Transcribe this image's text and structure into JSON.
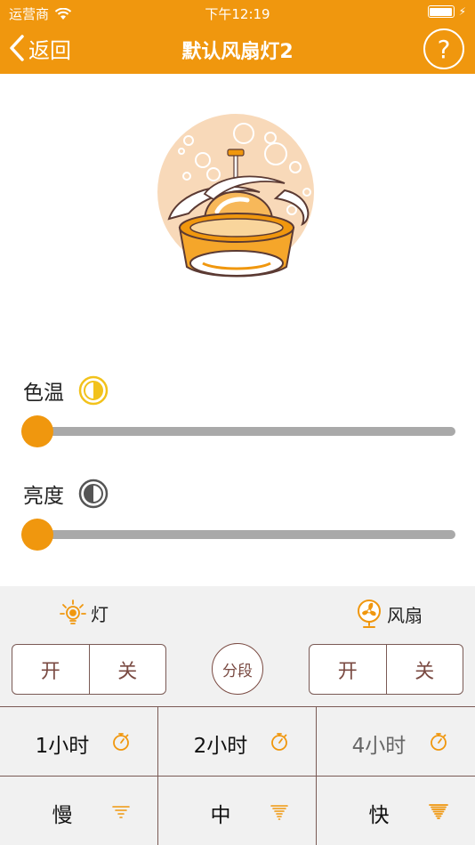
{
  "status_bar": {
    "carrier": "运营商",
    "time": "下午12:19"
  },
  "navbar": {
    "back_label": "返回",
    "title": "默认风扇灯2",
    "help_label": "?"
  },
  "sliders": {
    "color_temp": {
      "label": "色温",
      "value": 0
    },
    "brightness": {
      "label": "亮度",
      "value": 0
    }
  },
  "light": {
    "label": "灯",
    "on_label": "开",
    "off_label": "关"
  },
  "segment_label": "分段",
  "fan": {
    "label": "风扇",
    "on_label": "开",
    "off_label": "关"
  },
  "timers": [
    {
      "label": "1小时"
    },
    {
      "label": "2小时"
    },
    {
      "label": "4小时"
    }
  ],
  "speeds": [
    {
      "label": "慢"
    },
    {
      "label": "中"
    },
    {
      "label": "快"
    }
  ],
  "colors": {
    "accent": "#f0970e",
    "border": "#7a5a55",
    "button_text": "#7a4a42",
    "panel_bg": "#f1f1f1",
    "track": "#a9a9a9"
  }
}
